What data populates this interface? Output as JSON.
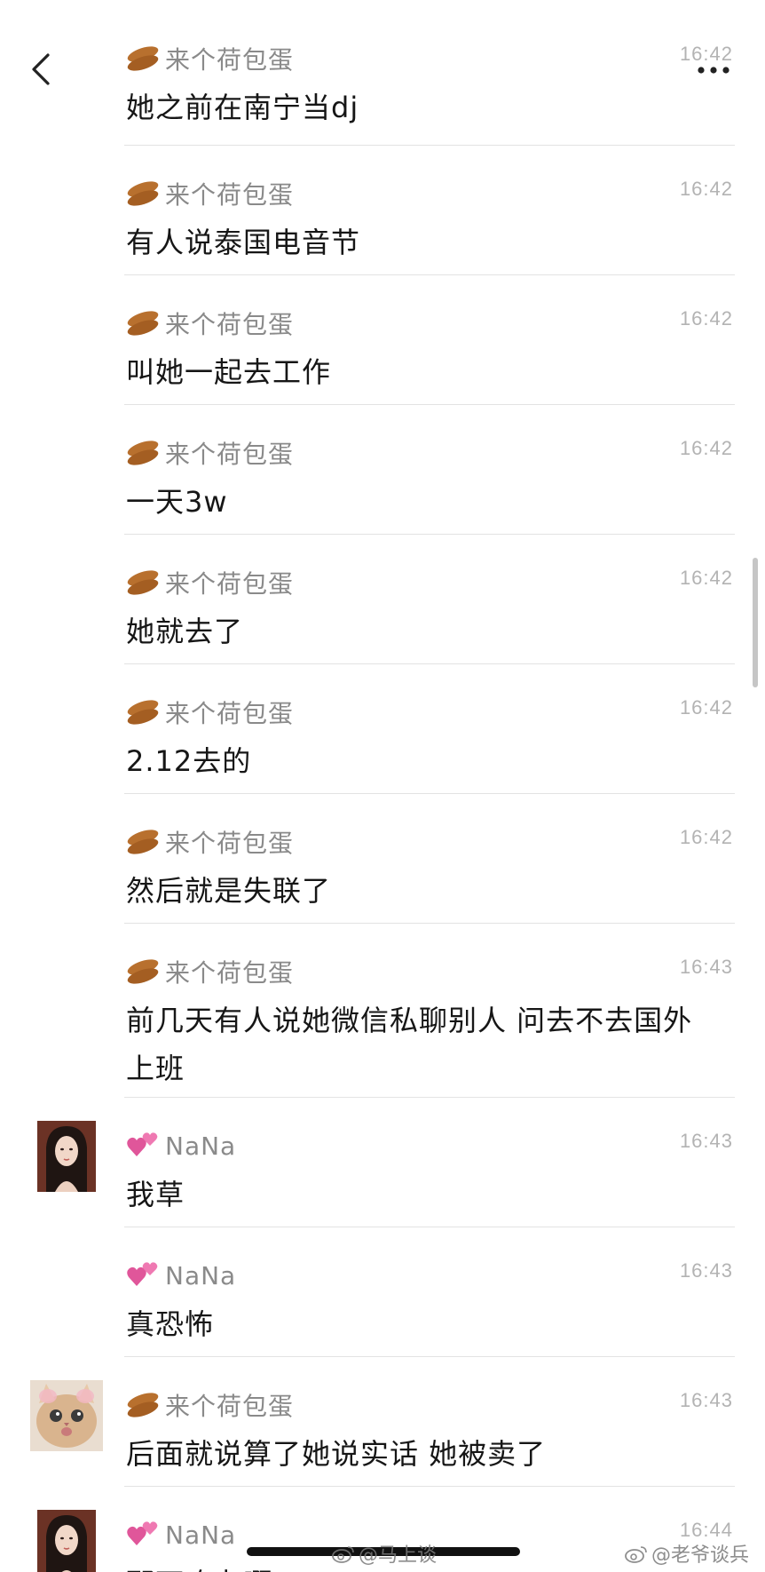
{
  "colors": {
    "name_gray": "#8a8a8a",
    "time_gray": "#b3b3b3",
    "divider": "#e3e3e3"
  },
  "nav": {
    "back_icon": "chevron-left-icon",
    "more_icon": "ellipsis-icon"
  },
  "messages": [
    {
      "sender": "来个荷包蛋",
      "emoji": "peanut",
      "time": "16:42",
      "text": "她之前在南宁当dj"
    },
    {
      "sender": "来个荷包蛋",
      "emoji": "peanut",
      "time": "16:42",
      "text": "有人说泰国电音节"
    },
    {
      "sender": "来个荷包蛋",
      "emoji": "peanut",
      "time": "16:42",
      "text": "叫她一起去工作"
    },
    {
      "sender": "来个荷包蛋",
      "emoji": "peanut",
      "time": "16:42",
      "text": "一天3w"
    },
    {
      "sender": "来个荷包蛋",
      "emoji": "peanut",
      "time": "16:42",
      "text": "她就去了"
    },
    {
      "sender": "来个荷包蛋",
      "emoji": "peanut",
      "time": "16:42",
      "text": "2.12去的"
    },
    {
      "sender": "来个荷包蛋",
      "emoji": "peanut",
      "time": "16:42",
      "text": "然后就是失联了"
    },
    {
      "sender": "来个荷包蛋",
      "emoji": "peanut",
      "time": "16:43",
      "text": "前几天有人说她微信私聊别人 问去不去国外上班"
    },
    {
      "sender": "NaNa",
      "emoji": "heart",
      "time": "16:43",
      "text": "我草",
      "avatar": "girl"
    },
    {
      "sender": "NaNa",
      "emoji": "heart",
      "time": "16:43",
      "text": "真恐怖"
    },
    {
      "sender": "来个荷包蛋",
      "emoji": "peanut",
      "time": "16:43",
      "text": "后面就说算了她说实话 她被卖了",
      "avatar": "cat"
    },
    {
      "sender": "NaNa",
      "emoji": "heart",
      "time": "16:44",
      "text": "那可咋办啊",
      "avatar": "girl"
    }
  ],
  "watermarks": {
    "left": "@马上谈",
    "right": "@老爷谈兵"
  }
}
